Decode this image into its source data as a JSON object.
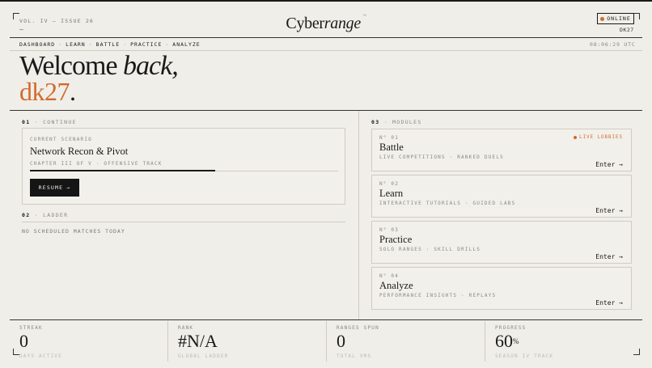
{
  "header": {
    "issue": "VOL. IV — ISSUE 26",
    "dash": "–",
    "brand_a": "Cyber",
    "brand_b": "range",
    "brand_mark": "™",
    "status": "ONLINE",
    "user": "DK27"
  },
  "nav": {
    "items": [
      "DASHBOARD",
      "LEARN",
      "BATTLE",
      "PRACTICE",
      "ANALYZE"
    ],
    "sep": "·",
    "clock": "08:06:29 UTC"
  },
  "welcome": {
    "line_a": "Welcome ",
    "line_b": "back,",
    "username": "dk27",
    "dot": "."
  },
  "continue": {
    "num": "01",
    "label": "· CONTINUE",
    "scenario_label": "CURRENT SCENARIO",
    "title": "Network Recon & Pivot",
    "subtitle": "CHAPTER III OF V · OFFENSIVE TRACK",
    "progress": 0.6,
    "resume_label": "RESUME",
    "resume_arrow": "→"
  },
  "ladder": {
    "num": "02",
    "label": "· LADDER",
    "empty": "NO SCHEDULED MATCHES TODAY"
  },
  "modules": {
    "num": "03",
    "label": "· MODULES",
    "live_label": "LIVE LOBBIES",
    "enter_label": "Enter →",
    "items": [
      {
        "num": "N° 01",
        "title": "Battle",
        "desc": "LIVE COMPETITIONS · RANKED DUELS"
      },
      {
        "num": "N° 02",
        "title": "Learn",
        "desc": "INTERACTIVE TUTORIALS · GUIDED LABS"
      },
      {
        "num": "N° 03",
        "title": "Practice",
        "desc": "SOLO RANGES · SKILL DRILLS"
      },
      {
        "num": "N° 04",
        "title": "Analyze",
        "desc": "PERFORMANCE INSIGHTS · REPLAYS"
      }
    ]
  },
  "stats": [
    {
      "label": "STREAK",
      "value": "0",
      "suffix": "",
      "sub": "DAYS ACTIVE"
    },
    {
      "label": "RANK",
      "value": "#N/A",
      "suffix": "",
      "sub": "GLOBAL LADDER"
    },
    {
      "label": "RANGES SPUN",
      "value": "0",
      "suffix": "",
      "sub": "TOTAL VMS"
    },
    {
      "label": "PROGRESS",
      "value": "60",
      "suffix": "%",
      "sub": "SEASON IV TRACK"
    }
  ],
  "colors": {
    "accent": "#d26a2e",
    "background": "#f0eee8",
    "ink": "#1a1a1a"
  }
}
